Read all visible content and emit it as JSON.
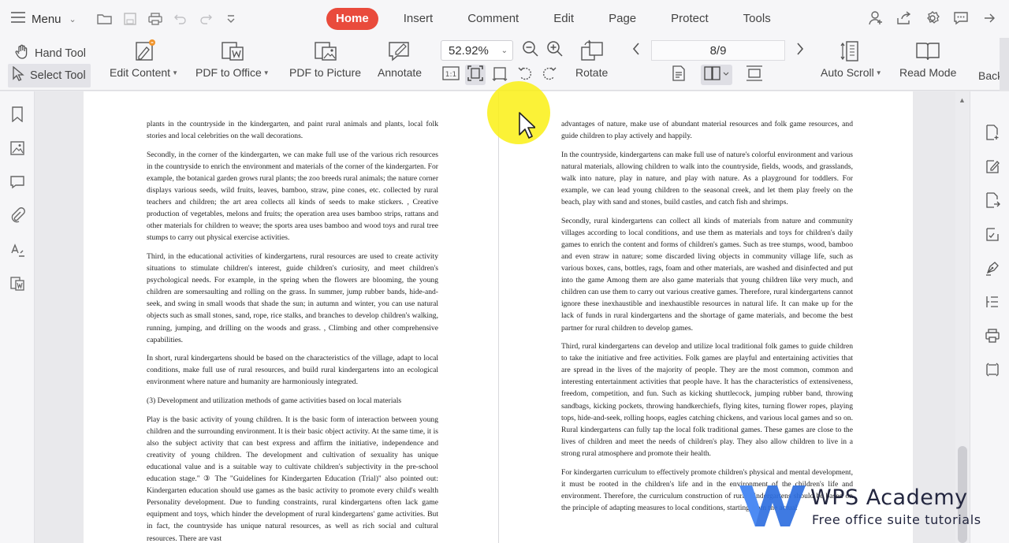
{
  "menubar": {
    "menu_label": "Menu",
    "tabs": [
      {
        "label": "Home",
        "active": true
      },
      {
        "label": "Insert"
      },
      {
        "label": "Comment"
      },
      {
        "label": "Edit"
      },
      {
        "label": "Page"
      },
      {
        "label": "Protect"
      },
      {
        "label": "Tools"
      }
    ]
  },
  "toolbar": {
    "hand_tool": "Hand Tool",
    "select_tool": "Select Tool",
    "edit_content": "Edit Content",
    "pdf_to_office": "PDF to Office",
    "pdf_to_picture": "PDF to Picture",
    "annotate": "Annotate",
    "zoom": "52.92%",
    "rotate": "Rotate",
    "page_indicator": "8/9",
    "auto_scroll": "Auto Scroll",
    "read_mode": "Read Mode",
    "background_partial": "Backg"
  },
  "document": {
    "left_page": [
      "plants in the countryside in the kindergarten, and paint rural animals and plants, local folk stories and local celebrities on the wall decorations.",
      "Secondly, in the corner of the kindergarten, we can make full use of the various rich resources in the countryside to enrich the environment and materials of the corner of the kindergarten. For example, the botanical garden grows rural plants; the zoo breeds rural animals; the nature corner displays various seeds, wild fruits, leaves, bamboo, straw, pine cones, etc. collected by rural teachers and children; the art area collects all kinds of seeds to make stickers. , Creative production of vegetables, melons and fruits; the operation area uses bamboo strips, rattans and other materials for children to weave; the sports area uses bamboo and wood toys and rural tree stumps to carry out physical exercise activities.",
      "Third, in the educational activities of kindergartens, rural resources are used to create activity situations to stimulate children's interest, guide children's curiosity, and meet children's psychological needs. For example, in the spring when the flowers are blooming, the young children are somersaulting and rolling on the grass. In summer, jump rubber bands, hide-and-seek, and swing in small woods that shade the sun; in autumn and winter, you can use natural objects such as small stones, sand, rope, rice stalks, and branches to develop children's walking, running, jumping, and drilling on the woods and grass. , Climbing and other comprehensive capabilities.",
      "In short, rural kindergartens should be based on the characteristics of the village, adapt to local conditions, make full use of rural resources, and build rural kindergartens into an ecological environment where nature and humanity are harmoniously integrated.",
      "(3) Development and utilization methods of game activities based on local materials",
      "Play is the basic activity of young children. It is the basic form of interaction between young children and the surrounding environment. It is their basic object activity. At the same time, it is also the subject activity that can best express and affirm the initiative, independence and creativity of young children. The development and cultivation of sexuality has unique educational value and is a suitable way to cultivate children's subjectivity in the pre-school education stage.\" ③ The \"Guidelines for Kindergarten Education (Trial)\" also pointed out: Kindergarten education should use games as the basic activity to promote every child's wealth Personality development. Due to funding constraints, rural kindergartens often lack game equipment and toys, which hinder the development of rural kindergartens' game activities. But in fact, the countryside has unique natural resources, as well as rich social and cultural resources. There are vast"
    ],
    "right_page": [
      "advantages of nature, make use of abundant material resources and folk game resources, and guide children to play actively and happily.",
      "In the countryside, kindergartens can make full use of nature's colorful environment and various natural materials, allowing children to walk into the countryside, fields, woods, and grasslands, walk into nature, play in nature, and play with nature. As a playground for toddlers. For example, we can lead young children to the seasonal creek, and let them play freely on the beach, play with sand and stones, build castles, and catch fish and shrimps.",
      "Secondly, rural kindergartens can collect all kinds of materials from nature and community villages according to local conditions, and use them as materials and toys for children's daily games to enrich the content and forms of children's games. Such as tree stumps, wood, bamboo and even straw in nature; some discarded living objects in community village life, such as various boxes, cans, bottles, rags, foam and other materials, are washed and disinfected and put into the game Among them are also game materials that young children like very much, and children can use them to carry out various creative games. Therefore, rural kindergartens cannot ignore these inexhaustible and inexhaustible resources in natural life. It can make up for the lack of funds in rural kindergartens and the shortage of game materials, and become the best partner for rural children to develop games.",
      "Third, rural kindergartens can develop and utilize local traditional folk games to guide children to take the initiative and free activities. Folk games are playful and entertaining activities that are spread in the lives of the majority of people. They are the most common, common and interesting entertainment activities that people have. It has the characteristics of extensiveness, freedom, competition, and fun. Such as kicking shuttlecock, jumping rubber band, throwing sandbags, kicking pockets, throwing handkerchiefs, flying kites, turning flower ropes, playing tops, hide-and-seek, rolling hoops, eagles catching chickens, and various local games and so on. Rural kindergartens can fully tap the local folk traditional games. These games are close to the lives of children and meet the needs of children's play. They also allow children to live in a strong rural atmosphere and promote their health.",
      "For kindergarten curriculum to effectively promote children's physical and mental development, it must be rooted in the children's life and in the environment of the children's life and environment. Therefore, the curriculum construction of rural kindergartens should be based on the principle of adapting measures to local conditions, starting from the actual"
    ]
  },
  "watermark": {
    "title": "WPS Academy",
    "subtitle": "Free office suite tutorials"
  }
}
